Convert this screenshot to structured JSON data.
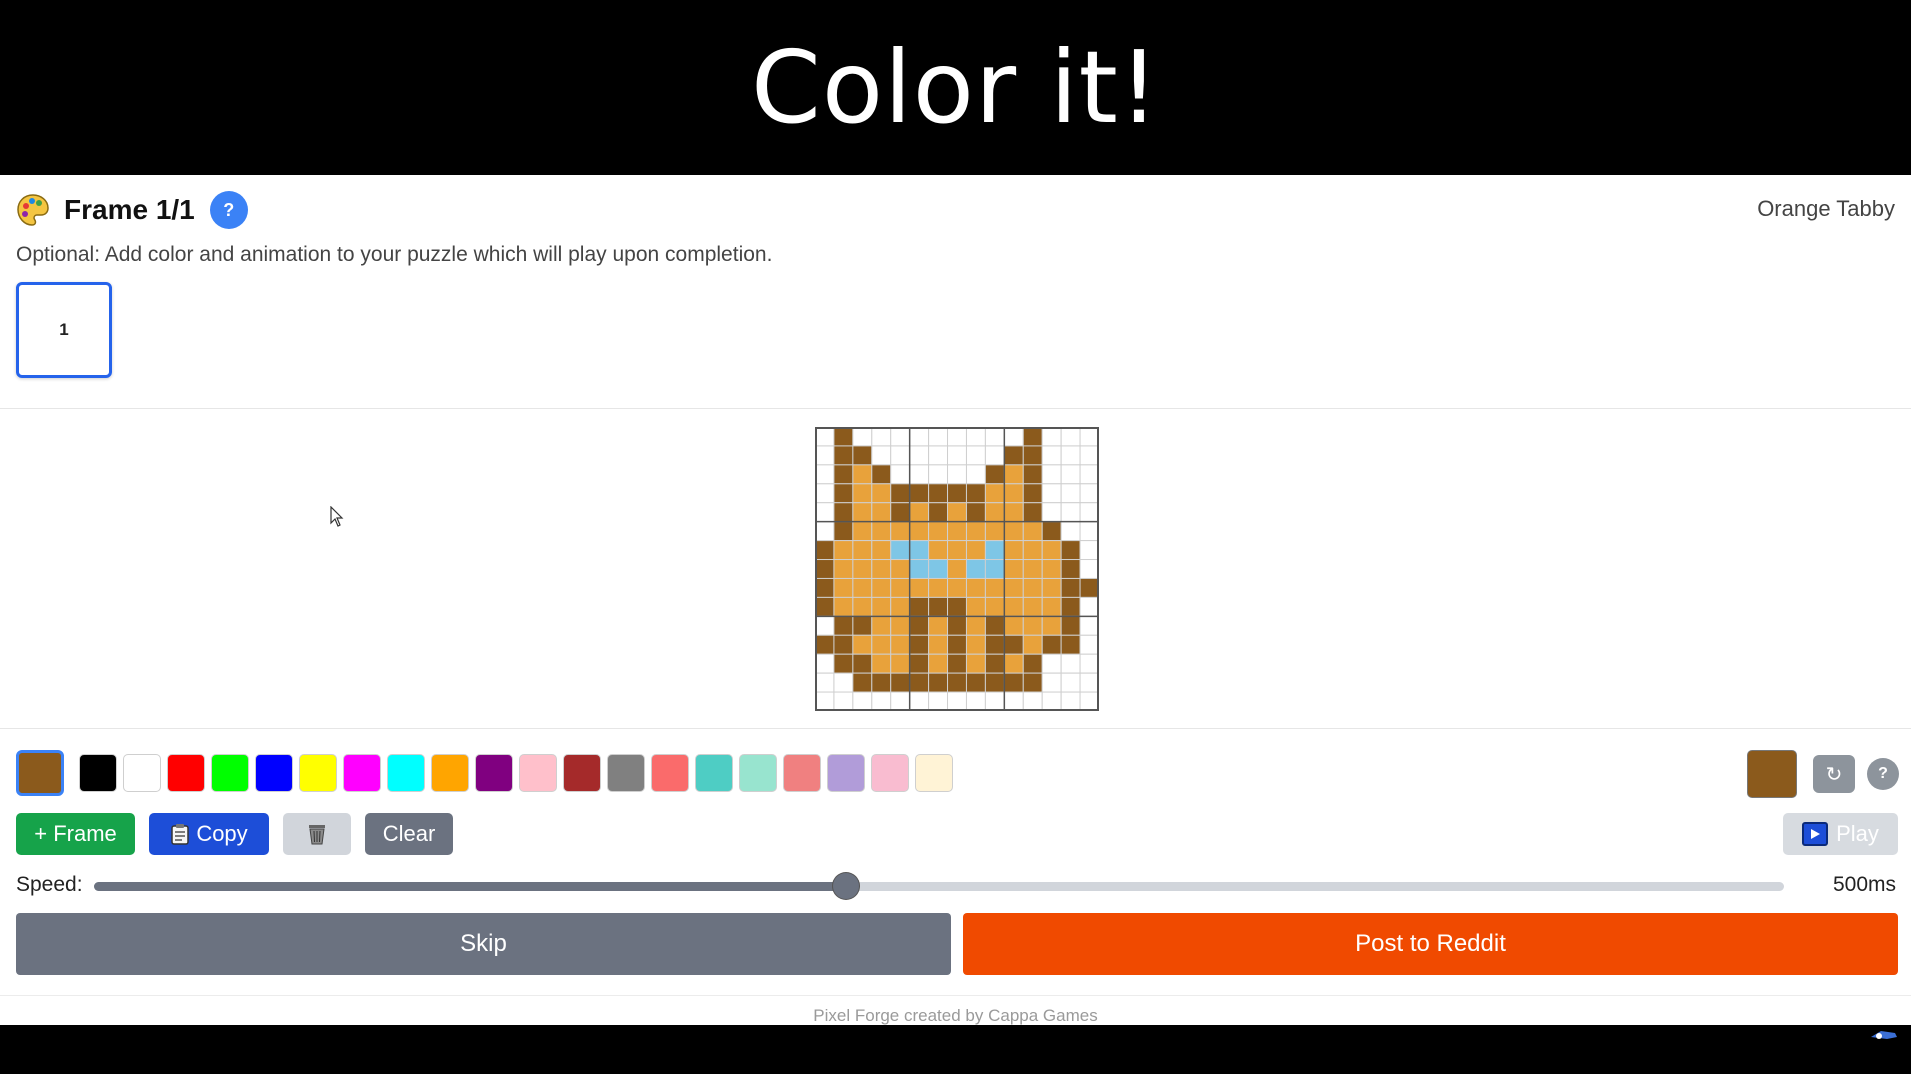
{
  "banner": {
    "title": "Color it!"
  },
  "header": {
    "frame_title": "Frame 1/1",
    "help_label": "?",
    "puzzle_name": "Orange Tabby",
    "subtitle": "Optional: Add color and animation to your puzzle which will play upon completion."
  },
  "frames": [
    {
      "label": "1"
    }
  ],
  "pixel_grid": {
    "size": 15,
    "colors": {
      ".": "#ffffff",
      "B": "#8b5a1c",
      "O": "#e8a23b",
      "L": "#7ec6e6"
    },
    "rows": [
      ".B.........B...",
      ".BB.......BB...",
      ".BOB.....BOB...",
      ".BOOBBBBBOOB...",
      ".BOOBOBOBOOB...",
      ".BOOOOOOOOOOB..",
      "BOOOLLOOOLOOOB.",
      "BOOOOLLOLLOOOB.",
      "BOOOOOOOOOOOOBB",
      "BOOOOBBBOOOOOB.",
      ".BBOOBOBOBOOOB.",
      "BBOOOBOBOBBOBB.",
      ".BBOOBOBOBOB...",
      "..BBBBBBBBBB...",
      "..............."
    ]
  },
  "palette": {
    "selected": "#8b5a1c",
    "swatches": [
      "#000000",
      "#ffffff",
      "#ff0000",
      "#00ff00",
      "#0000ff",
      "#ffff00",
      "#ff00ff",
      "#00ffff",
      "#ffa500",
      "#800080",
      "#ffc0cb",
      "#a52a2a",
      "#808080",
      "#fa6b6b",
      "#4ecdc4",
      "#98e4cf",
      "#f08080",
      "#b19cd9",
      "#f9bcd0",
      "#fff3d6"
    ]
  },
  "tools": {
    "reset_icon": "↻",
    "help_label": "?"
  },
  "actions": {
    "add_frame": "+ Frame",
    "copy": "Copy",
    "clear": "Clear",
    "play": "Play"
  },
  "speed": {
    "label": "Speed:",
    "value_text": "500ms",
    "value_ms": 500,
    "fraction": 0.445
  },
  "footer": {
    "skip": "Skip",
    "post": "Post to Reddit",
    "credit": "Pixel Forge created by Cappa Games"
  }
}
